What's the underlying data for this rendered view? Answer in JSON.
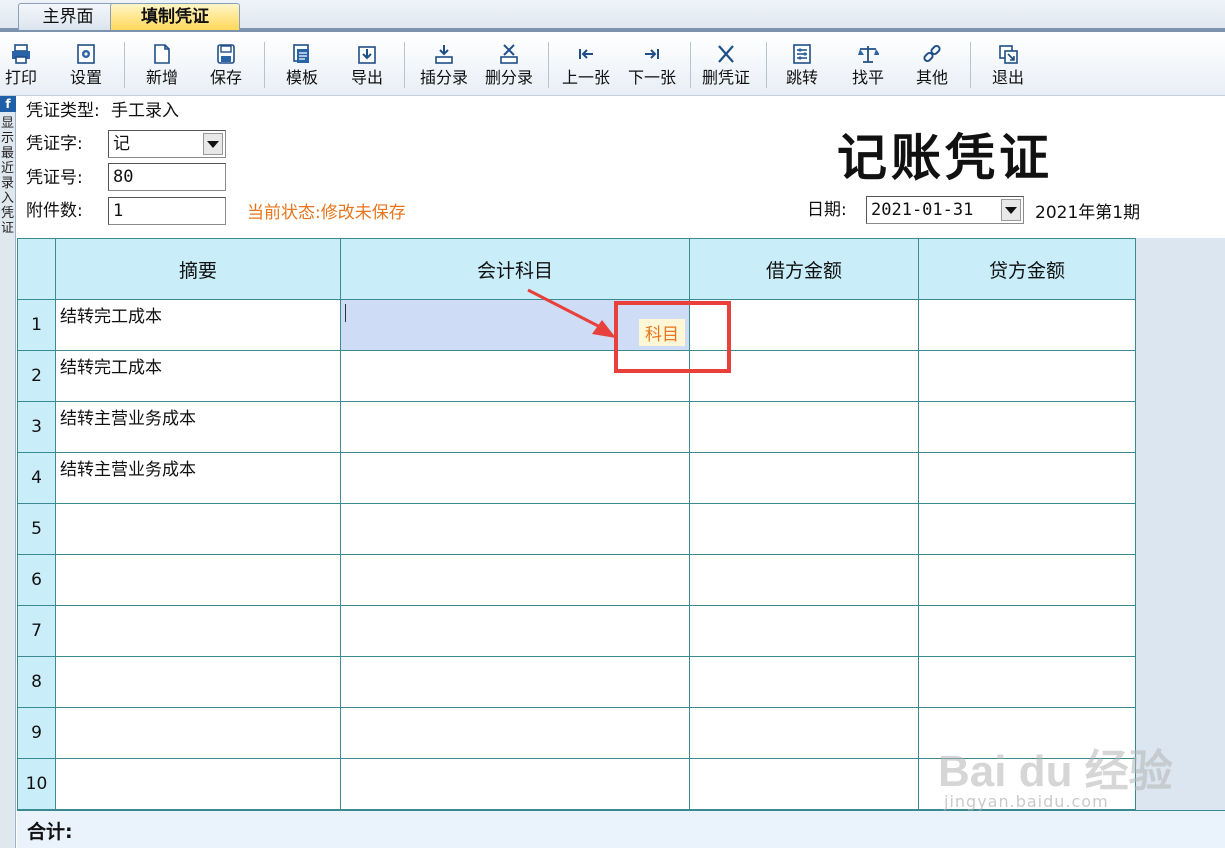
{
  "tabs": {
    "main": "主界面",
    "active": "填制凭证"
  },
  "toolbar": [
    {
      "id": "print",
      "label": "打印",
      "icon": "printer-icon"
    },
    {
      "id": "settings",
      "label": "设置",
      "icon": "gear-icon"
    },
    {
      "id": "new",
      "label": "新增",
      "icon": "new-document-icon"
    },
    {
      "id": "save",
      "label": "保存",
      "icon": "save-icon"
    },
    {
      "id": "template",
      "label": "模板",
      "icon": "template-icon"
    },
    {
      "id": "export",
      "label": "导出",
      "icon": "export-icon"
    },
    {
      "id": "insert-entry",
      "label": "插分录",
      "icon": "insert-entry-icon"
    },
    {
      "id": "delete-entry",
      "label": "删分录",
      "icon": "delete-entry-icon"
    },
    {
      "id": "prev",
      "label": "上一张",
      "icon": "previous-icon"
    },
    {
      "id": "next",
      "label": "下一张",
      "icon": "next-icon"
    },
    {
      "id": "delete-voucher",
      "label": "删凭证",
      "icon": "delete-x-icon"
    },
    {
      "id": "jump",
      "label": "跳转",
      "icon": "jump-icon"
    },
    {
      "id": "balance",
      "label": "找平",
      "icon": "balance-scale-icon"
    },
    {
      "id": "other",
      "label": "其他",
      "icon": "link-icon"
    },
    {
      "id": "exit",
      "label": "退出",
      "icon": "exit-icon"
    }
  ],
  "side_strip": {
    "badge": "f",
    "text": "显示最近录入凭证"
  },
  "header": {
    "voucher_type_label": "凭证类型:",
    "voucher_type_value": "手工录入",
    "voucher_word_label": "凭证字:",
    "voucher_word_value": "记",
    "voucher_no_label": "凭证号:",
    "voucher_no_value": "80",
    "attachments_label": "附件数:",
    "attachments_value": "1",
    "status": "当前状态:修改未保存",
    "title": "记账凭证",
    "date_label": "日期:",
    "date_value": "2021-01-31",
    "period": "2021年第1期"
  },
  "grid": {
    "columns": [
      "",
      "摘要",
      "会计科目",
      "借方金额",
      "贷方金额"
    ],
    "rows": [
      {
        "no": "1",
        "summary": "结转完工成本",
        "account": "",
        "debit": "",
        "credit": ""
      },
      {
        "no": "2",
        "summary": "结转完工成本",
        "account": "",
        "debit": "",
        "credit": ""
      },
      {
        "no": "3",
        "summary": "结转主营业务成本",
        "account": "",
        "debit": "",
        "credit": ""
      },
      {
        "no": "4",
        "summary": "结转主营业务成本",
        "account": "",
        "debit": "",
        "credit": ""
      },
      {
        "no": "5",
        "summary": "",
        "account": "",
        "debit": "",
        "credit": ""
      },
      {
        "no": "6",
        "summary": "",
        "account": "",
        "debit": "",
        "credit": ""
      },
      {
        "no": "7",
        "summary": "",
        "account": "",
        "debit": "",
        "credit": ""
      },
      {
        "no": "8",
        "summary": "",
        "account": "",
        "debit": "",
        "credit": ""
      },
      {
        "no": "9",
        "summary": "",
        "account": "",
        "debit": "",
        "credit": ""
      },
      {
        "no": "10",
        "summary": "",
        "account": "",
        "debit": "",
        "credit": ""
      }
    ],
    "active_hint": "科目"
  },
  "totals": {
    "label": "合计:"
  },
  "watermark": {
    "brand": "Bai du 经验",
    "url": "jingyan.baidu.com"
  },
  "colors": {
    "accent": "#e8761e",
    "annotation": "#e8403a",
    "header_fill": "#c9eef9",
    "grid_line": "#3a8a92"
  }
}
